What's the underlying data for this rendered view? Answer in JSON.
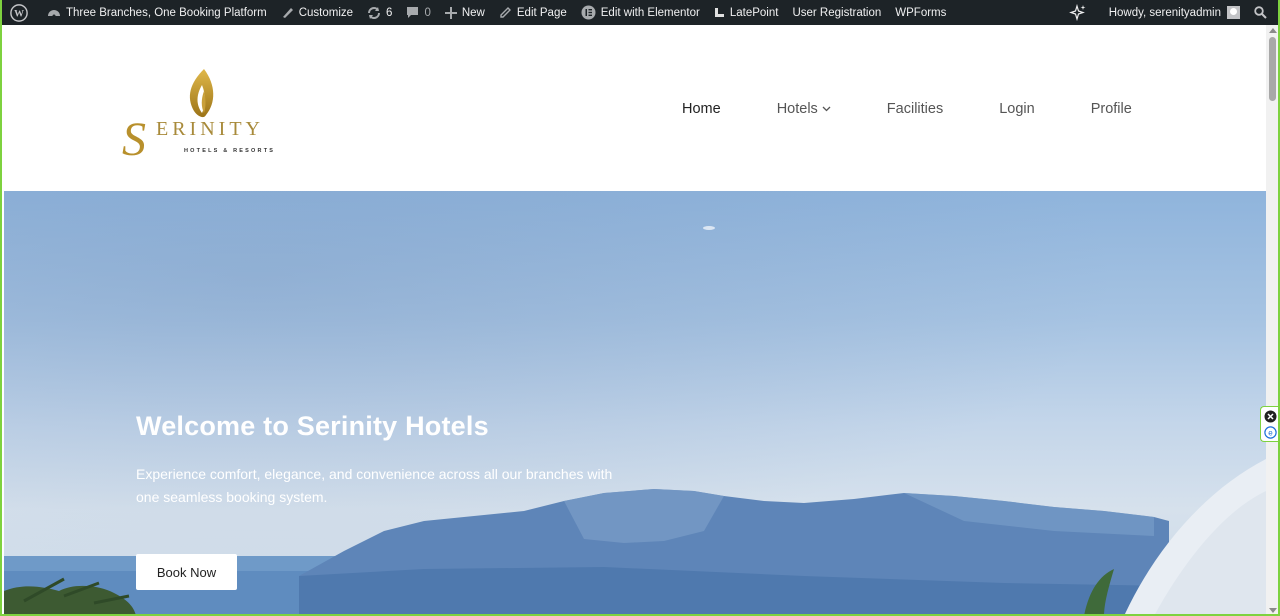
{
  "adminbar": {
    "site_name": "Three Branches, One Booking Platform",
    "customize": "Customize",
    "updates_count": "6",
    "comments_count": "0",
    "new": "New",
    "edit_page": "Edit Page",
    "edit_elementor": "Edit with Elementor",
    "latepoint": "LatePoint",
    "user_registration": "User Registration",
    "wpforms": "WPForms",
    "howdy": "Howdy, serenityadmin"
  },
  "logo": {
    "wordmark": "ERINITY",
    "tagline": "HOTELS & RESORTS",
    "initial": "S",
    "gold": "#b8902c"
  },
  "nav": {
    "items": [
      "Home",
      "Hotels",
      "Facilities",
      "Login",
      "Profile"
    ]
  },
  "hero": {
    "title": "Welcome to Serinity Hotels",
    "subtitle": "Experience comfort, elegance, and convenience across all our branches with one seamless booking system.",
    "button": "Book Now"
  },
  "colors": {
    "adminbar": "#1d2327",
    "frame": "#7ed23f"
  }
}
